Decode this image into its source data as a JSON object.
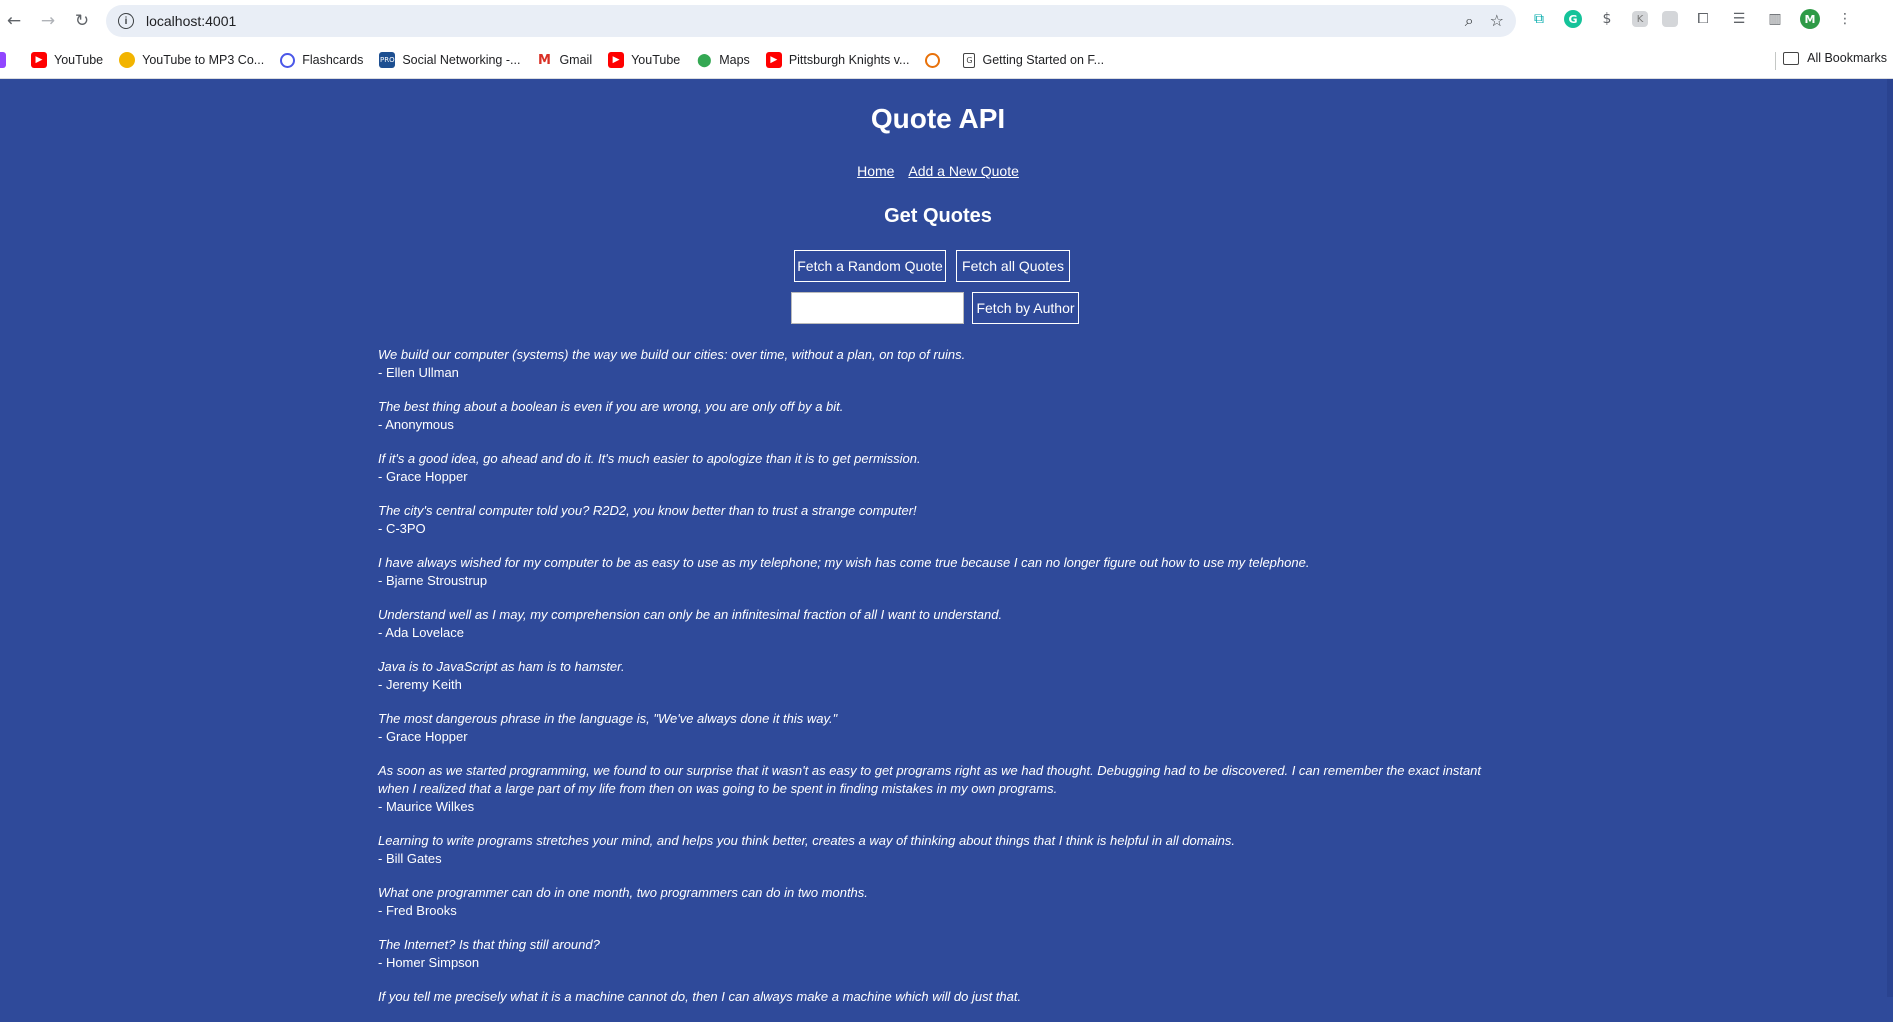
{
  "browser": {
    "url": "localhost:4001",
    "profile_initial": "M",
    "bookmarks": [
      {
        "label": "YouTube",
        "icon": "youtube-icon"
      },
      {
        "label": "YouTube to MP3 Co...",
        "icon": "converter-icon"
      },
      {
        "label": "Flashcards",
        "icon": "quizlet-icon"
      },
      {
        "label": "Social Networking -...",
        "icon": "procon-icon"
      },
      {
        "label": "Gmail",
        "icon": "gmail-icon"
      },
      {
        "label": "YouTube",
        "icon": "youtube-icon"
      },
      {
        "label": "Maps",
        "icon": "maps-icon"
      },
      {
        "label": "Pittsburgh Knights v...",
        "icon": "youtube-icon"
      },
      {
        "label": "Getting Started on F...",
        "icon": "doc-icon"
      }
    ],
    "all_bookmarks_label": "All Bookmarks"
  },
  "page": {
    "title": "Quote API",
    "nav": {
      "home": "Home",
      "add": "Add a New Quote"
    },
    "subtitle": "Get Quotes",
    "buttons": {
      "random": "Fetch a Random Quote",
      "all": "Fetch all Quotes",
      "author": "Fetch by Author"
    },
    "author_input_value": "",
    "background_color": "#2f4a9a"
  },
  "quotes": [
    {
      "text": "We build our computer (systems) the way we build our cities: over time, without a plan, on top of ruins.",
      "author": "- Ellen Ullman"
    },
    {
      "text": "The best thing about a boolean is even if you are wrong, you are only off by a bit.",
      "author": "- Anonymous"
    },
    {
      "text": "If it's a good idea, go ahead and do it. It's much easier to apologize than it is to get permission.",
      "author": "- Grace Hopper"
    },
    {
      "text": "The city's central computer told you? R2D2, you know better than to trust a strange computer!",
      "author": "- C-3PO"
    },
    {
      "text": "I have always wished for my computer to be as easy to use as my telephone; my wish has come true because I can no longer figure out how to use my telephone.",
      "author": "- Bjarne Stroustrup"
    },
    {
      "text": "Understand well as I may, my comprehension can only be an infinitesimal fraction of all I want to understand.",
      "author": "- Ada Lovelace"
    },
    {
      "text": "Java is to JavaScript as ham is to hamster.",
      "author": "- Jeremy Keith"
    },
    {
      "text": "The most dangerous phrase in the language is, \"We've always done it this way.\"",
      "author": "- Grace Hopper"
    },
    {
      "text": "As soon as we started programming, we found to our surprise that it wasn't as easy to get programs right as we had thought. Debugging had to be discovered. I can remember the exact instant when I realized that a large part of my life from then on was going to be spent in finding mistakes in my own programs.",
      "author": "- Maurice Wilkes"
    },
    {
      "text": "Learning to write programs stretches your mind, and helps you think better, creates a way of thinking about things that I think is helpful in all domains.",
      "author": "- Bill Gates"
    },
    {
      "text": "What one programmer can do in one month, two programmers can do in two months.",
      "author": "- Fred Brooks"
    },
    {
      "text": "The Internet? Is that thing still around?",
      "author": "- Homer Simpson"
    },
    {
      "text": "If you tell me precisely what it is a machine cannot do, then I can always make a machine which will do just that.",
      "author": ""
    }
  ]
}
